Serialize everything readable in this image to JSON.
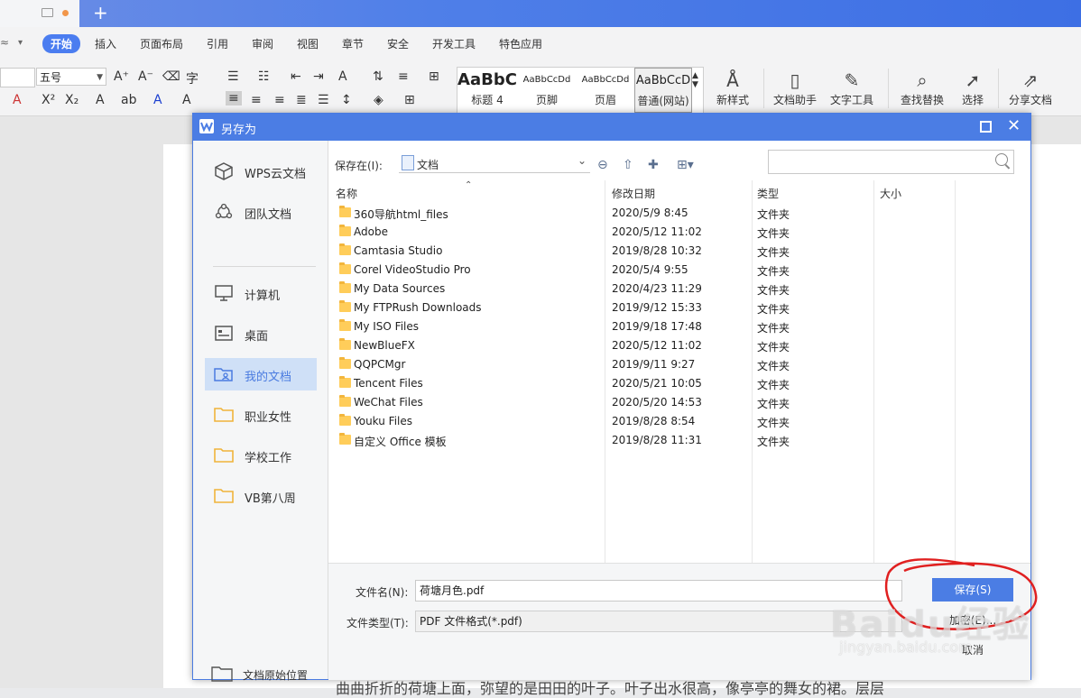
{
  "app": {
    "menu": [
      "开始",
      "插入",
      "页面布局",
      "引用",
      "审阅",
      "视图",
      "章节",
      "安全",
      "开发工具",
      "特色应用"
    ],
    "active_menu": "开始",
    "font_size": "五号",
    "styles": [
      {
        "preview": "AaBbC",
        "label": "标题 4"
      },
      {
        "preview": "AaBbCcDd",
        "label": "页脚"
      },
      {
        "preview": "AaBbCcDd",
        "label": "页眉"
      },
      {
        "preview": "AaBbCcD",
        "label": "普通(网站)"
      }
    ],
    "tools": [
      "新样式",
      "文档助手",
      "文字工具",
      "查找替换",
      "选择",
      "分享文档"
    ],
    "page_text": "曲曲折折的荷塘上面，弥望的是田田的叶子。叶子出水很高，像亭亭的舞女的裙。层层"
  },
  "dialog": {
    "title": "另存为",
    "sidebar": [
      {
        "label": "WPS云文档",
        "icon": "cube-icon"
      },
      {
        "label": "团队文档",
        "icon": "team-icon"
      },
      {
        "label": "计算机",
        "icon": "monitor-icon"
      },
      {
        "label": "桌面",
        "icon": "desktop-icon"
      },
      {
        "label": "我的文档",
        "icon": "my-docs-icon",
        "selected": true
      },
      {
        "label": "职业女性",
        "icon": "folder-icon"
      },
      {
        "label": "学校工作",
        "icon": "folder-icon"
      },
      {
        "label": "VB第八周",
        "icon": "folder-icon"
      }
    ],
    "sidebar_bottom": "文档原始位置",
    "location_label": "保存在(I):",
    "location_value": "文档",
    "search_placeholder": "",
    "columns": [
      "名称",
      "修改日期",
      "类型",
      "大小"
    ],
    "files": [
      {
        "name": "360导航html_files",
        "date": "2020/5/9 8:45",
        "type": "文件夹"
      },
      {
        "name": "Adobe",
        "date": "2020/5/12 11:02",
        "type": "文件夹"
      },
      {
        "name": "Camtasia Studio",
        "date": "2019/8/28 10:32",
        "type": "文件夹"
      },
      {
        "name": "Corel VideoStudio Pro",
        "date": "2020/5/4 9:55",
        "type": "文件夹"
      },
      {
        "name": "My Data Sources",
        "date": "2020/4/23 11:29",
        "type": "文件夹"
      },
      {
        "name": "My FTPRush Downloads",
        "date": "2019/9/12 15:33",
        "type": "文件夹"
      },
      {
        "name": "My ISO Files",
        "date": "2019/9/18 17:48",
        "type": "文件夹"
      },
      {
        "name": "NewBlueFX",
        "date": "2020/5/12 11:02",
        "type": "文件夹"
      },
      {
        "name": "QQPCMgr",
        "date": "2019/9/11 9:27",
        "type": "文件夹"
      },
      {
        "name": "Tencent Files",
        "date": "2020/5/21 10:05",
        "type": "文件夹"
      },
      {
        "name": "WeChat Files",
        "date": "2020/5/20 14:53",
        "type": "文件夹"
      },
      {
        "name": "Youku Files",
        "date": "2019/8/28 8:54",
        "type": "文件夹"
      },
      {
        "name": "自定义 Office 模板",
        "date": "2019/8/28 11:31",
        "type": "文件夹"
      }
    ],
    "filename_label": "文件名(N):",
    "filename_value": "荷塘月色.pdf",
    "filetype_label": "文件类型(T):",
    "filetype_value": "PDF 文件格式(*.pdf)",
    "save_label": "保存(S)",
    "encrypt_label": "加密(E)...",
    "cancel_label": "取消"
  },
  "watermark": {
    "logo": "Baidu经验",
    "url": "jingyan.baidu.com"
  },
  "colors": {
    "accent": "#4b7de4",
    "selected": "#cfe0f7",
    "folder": "#ffcd5a",
    "annotation": "#e02020"
  }
}
